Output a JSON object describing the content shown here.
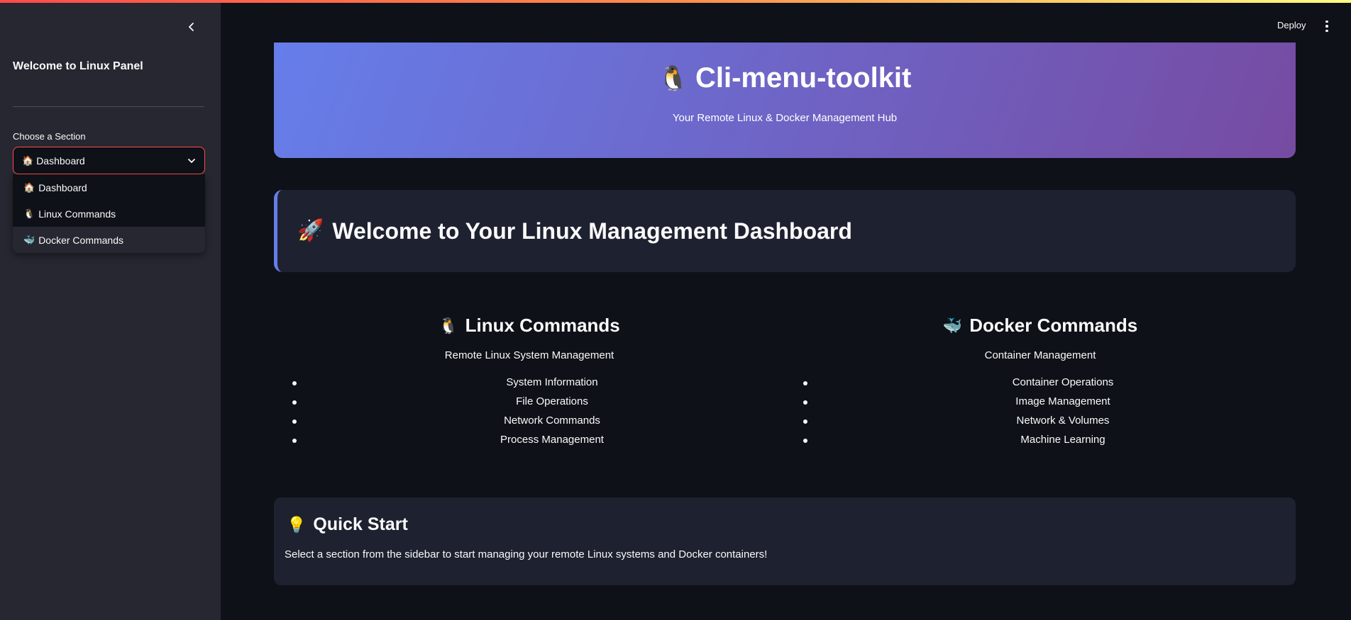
{
  "sidebar": {
    "title": "Welcome to Linux Panel",
    "select_label": "Choose a Section",
    "selected": {
      "icon": "🏠",
      "label": "Dashboard"
    },
    "options": [
      {
        "icon": "🏠",
        "label": "Dashboard"
      },
      {
        "icon": "🐧",
        "label": "Linux Commands"
      },
      {
        "icon": "🐳",
        "label": "Docker Commands"
      }
    ]
  },
  "header": {
    "deploy_label": "Deploy"
  },
  "hero": {
    "icon": "🐧",
    "title": "Cli-menu-toolkit",
    "subtitle": "Your Remote Linux & Docker Management Hub"
  },
  "welcome": {
    "icon": "🚀",
    "title": "Welcome to Your Linux Management Dashboard"
  },
  "features": {
    "linux": {
      "icon": "🐧",
      "title": "Linux Commands",
      "subtitle": "Remote Linux System Management",
      "items": [
        "System Information",
        "File Operations",
        "Network Commands",
        "Process Management"
      ]
    },
    "docker": {
      "icon": "🐳",
      "title": "Docker Commands",
      "subtitle": "Container Management",
      "items": [
        "Container Operations",
        "Image Management",
        "Network & Volumes",
        "Machine Learning"
      ]
    }
  },
  "quick_start": {
    "icon": "💡",
    "title": "Quick Start",
    "text": "Select a section from the sidebar to start managing your remote Linux systems and Docker containers!"
  },
  "colors": {
    "accent": "#ff4b4b",
    "hero_start": "#667eea",
    "hero_end": "#764ba2",
    "background": "#0e1117",
    "sidebar": "#262730",
    "card": "#1e2130"
  }
}
